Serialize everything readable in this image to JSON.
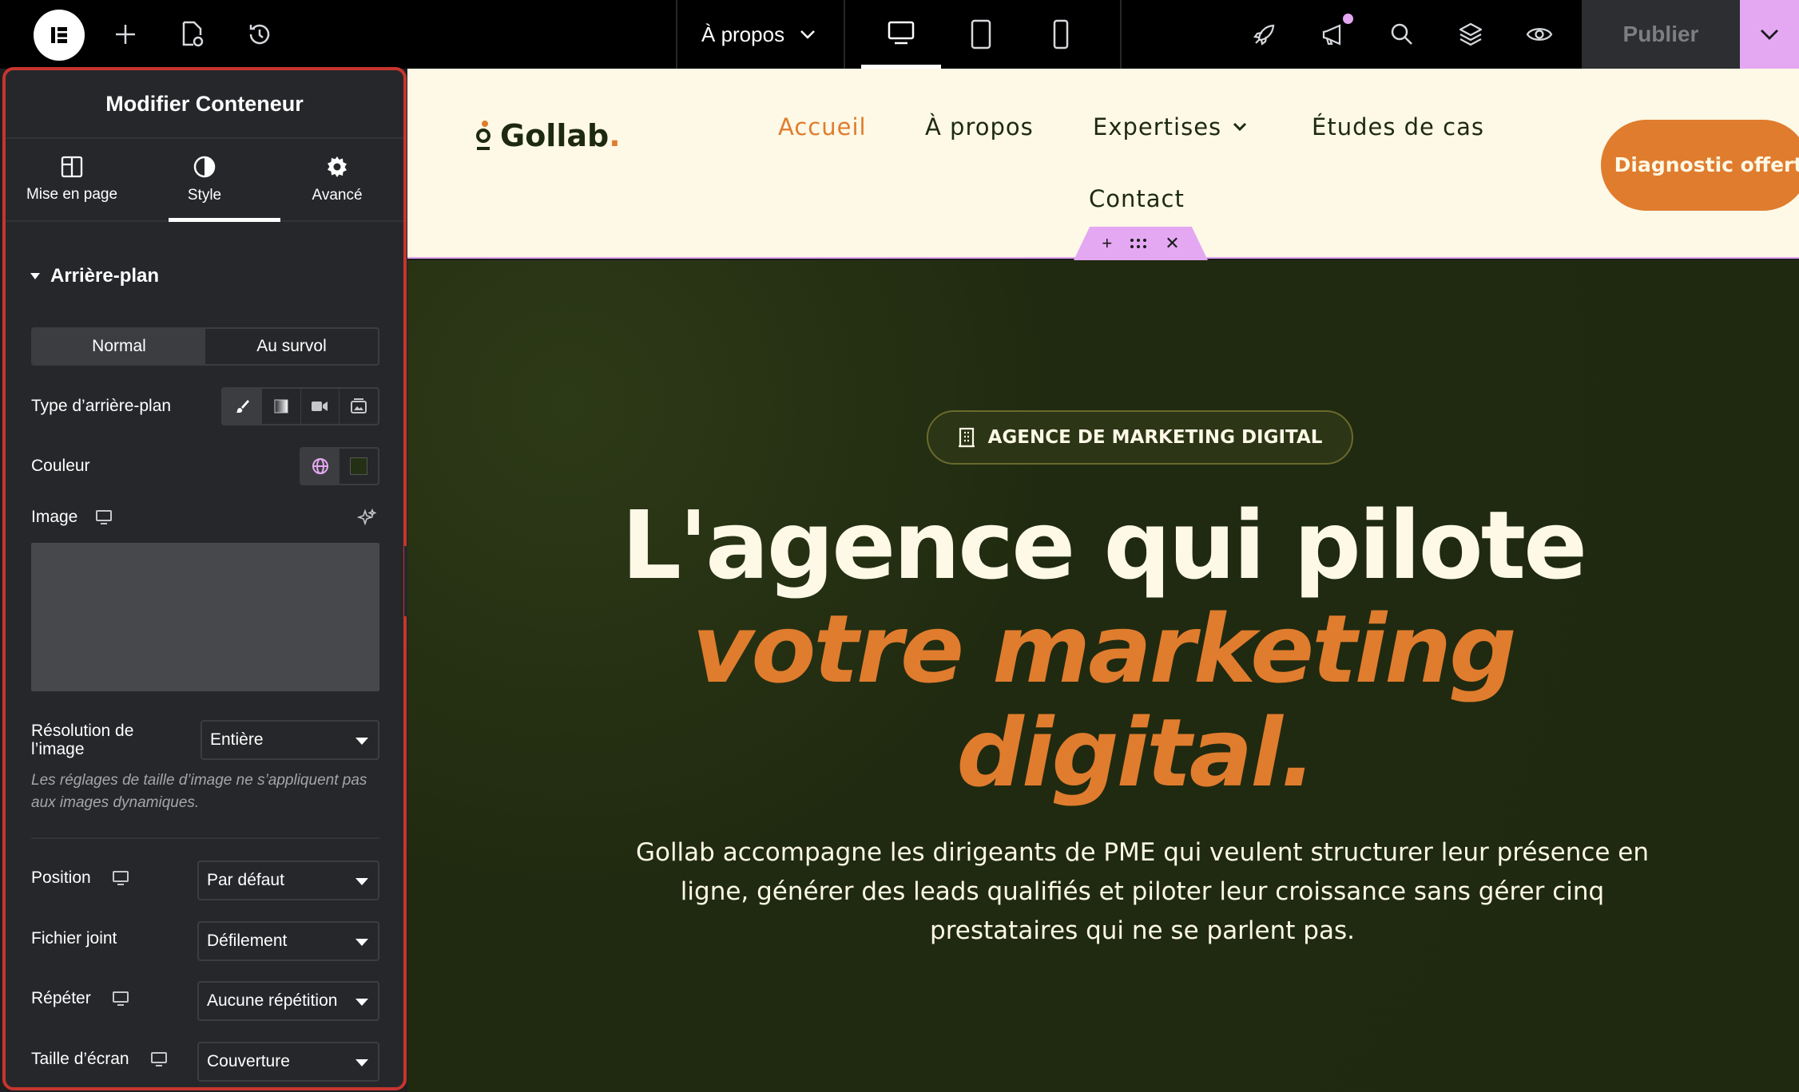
{
  "topbar": {
    "page_selector": "À propos",
    "publish_label": "Publier"
  },
  "panel": {
    "title": "Modifier Conteneur",
    "tabs": [
      {
        "label": "Mise en page",
        "icon": "layout-icon"
      },
      {
        "label": "Style",
        "icon": "contrast-icon"
      },
      {
        "label": "Avancé",
        "icon": "gear-icon"
      }
    ],
    "section_title": "Arrière-plan",
    "state_normal": "Normal",
    "state_hover": "Au survol",
    "bg_type_label": "Type d’arrière-plan",
    "color_label": "Couleur",
    "color_value": "#243014",
    "image_label": "Image",
    "resolution_label": "Résolution de l’image",
    "resolution_value": "Entière",
    "hint": "Les réglages de taille d’image ne s’appliquent pas aux images dynamiques.",
    "position_label": "Position",
    "position_value": "Par défaut",
    "attachment_label": "Fichier joint",
    "attachment_value": "Défilement",
    "repeat_label": "Répéter",
    "repeat_value": "Aucune répétition",
    "size_label": "Taille d’écran",
    "size_value": "Couverture"
  },
  "site": {
    "brand": "Gollab",
    "brand_dot": ".",
    "nav": [
      "Accueil",
      "À propos",
      "Expertises",
      "Études de cas",
      "Contact"
    ],
    "cta": "Diagnostic offert",
    "badge": "AGENCE DE MARKETING DIGITAL",
    "headline_1": "L'agence qui pilote",
    "headline_2": "votre marketing",
    "headline_3": "digital.",
    "lead": "Gollab accompagne les dirigeants de PME qui veulent structurer leur présence en ligne, générer des leads qualifiés et piloter leur croissance sans gérer cinq prestataires qui ne se parlent pas."
  },
  "colors": {
    "accent": "#e07c2e",
    "hero_bg": "#1f2910",
    "cream": "#fdf9e6",
    "editor_highlight": "#e4a8f3"
  }
}
